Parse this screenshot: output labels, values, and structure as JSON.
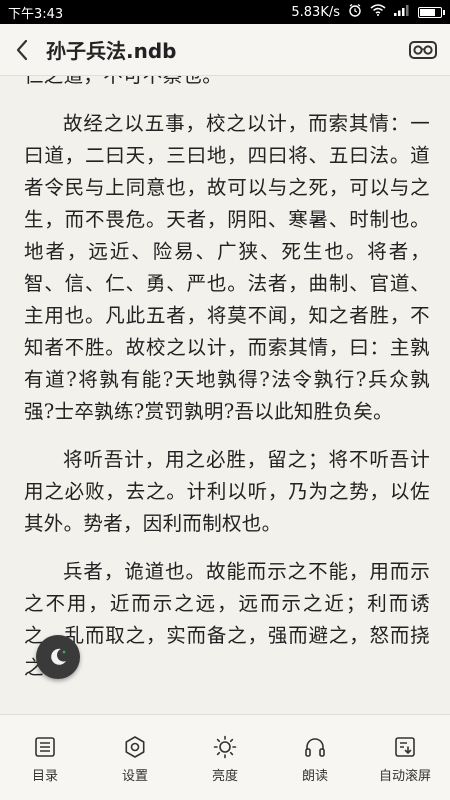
{
  "status_bar": {
    "time": "下午3:43",
    "speed": "5.83K/s"
  },
  "app_bar": {
    "title": "孙子兵法.ndb"
  },
  "content": {
    "paragraphs": [
      "仁之道，不可不察也。",
      "故经之以五事，校之以计，而索其情：一曰道，二曰天，三曰地，四曰将、五曰法。道者令民与上同意也，故可以与之死，可以与之生，而不畏危。天者，阴阳、寒暑、时制也。地者，远近、险易、广狭、死生也。将者，智、信、仁、勇、严也。法者，曲制、官道、主用也。凡此五者，将莫不闻，知之者胜，不知者不胜。故校之以计，而索其情，曰：主孰有道?将孰有能?天地孰得?法令孰行?兵众孰强?士卒孰练?赏罚孰明?吾以此知胜负矣。",
      "将听吾计，用之必胜，留之；将不听吾计用之必败，去之。计利以听，乃为之势，以佐其外。势者，因利而制权也。",
      "兵者，诡道也。故能而示之不能，用而示之不用，近而示之远，远而示之近；利而诱之，乱而取之，实而备之，强而避之，怒而挠之。"
    ]
  },
  "toolbar": {
    "items": [
      {
        "label": "目录",
        "icon": "list-icon"
      },
      {
        "label": "设置",
        "icon": "settings-icon"
      },
      {
        "label": "亮度",
        "icon": "brightness-icon"
      },
      {
        "label": "朗读",
        "icon": "headphones-icon"
      },
      {
        "label": "自动滚屏",
        "icon": "auto-scroll-icon"
      }
    ]
  }
}
